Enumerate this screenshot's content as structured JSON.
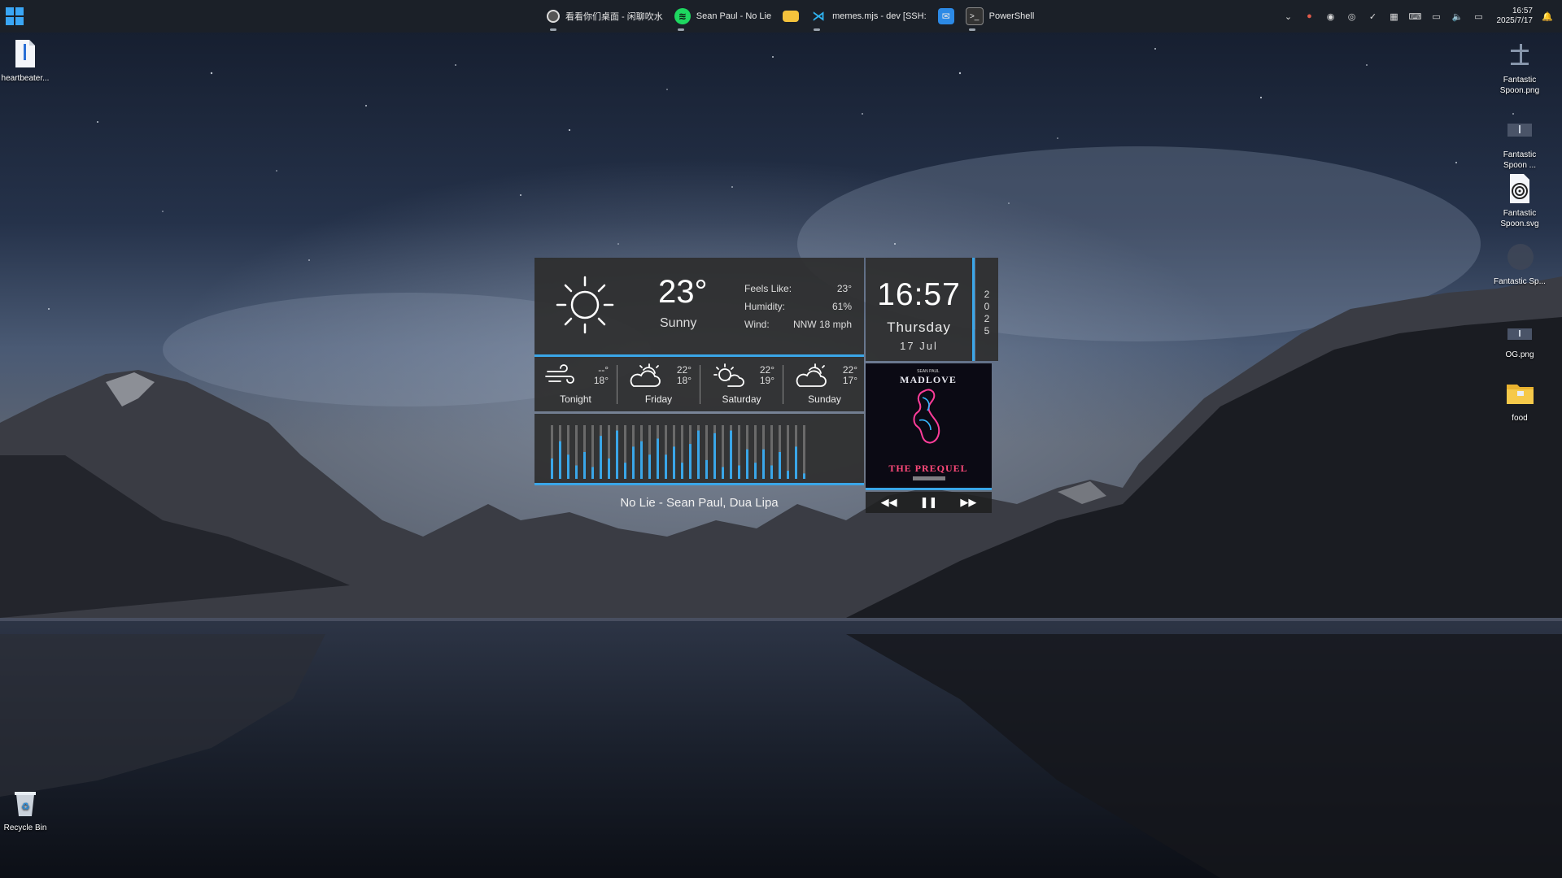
{
  "taskbar": {
    "apps": [
      {
        "label": "看看你们桌面 - 闲聊吹水",
        "icon": "chrome-icon"
      },
      {
        "label": "Sean Paul - No Lie",
        "icon": "spotify-icon"
      },
      {
        "label": "",
        "icon": "file-explorer-icon"
      },
      {
        "label": "memes.mjs - dev [SSH:",
        "icon": "vscode-icon"
      },
      {
        "label": "",
        "icon": "mail-icon"
      },
      {
        "label": "PowerShell",
        "icon": "powershell-icon"
      }
    ],
    "clock_time": "16:57",
    "clock_date": "2025/7/17"
  },
  "desktop": {
    "left_icons": [
      {
        "label": "heartbeater...",
        "icon": "zip-file-icon"
      },
      {
        "label": "Recycle Bin",
        "icon": "recycle-bin-icon"
      }
    ],
    "right_icons": [
      {
        "label": "Fantastic Spoon.png",
        "icon": "image-file-icon"
      },
      {
        "label": "Fantastic Spoon ...",
        "icon": "image-file-icon"
      },
      {
        "label": "Fantastic Spoon.svg",
        "icon": "svg-file-icon"
      },
      {
        "label": "Fantastic Sp...",
        "icon": "image-file-icon"
      },
      {
        "label": "OG.png",
        "icon": "image-file-icon"
      },
      {
        "label": "food",
        "icon": "folder-icon"
      }
    ]
  },
  "weather": {
    "temp": "23°",
    "condition": "Sunny",
    "feels_like_label": "Feels Like:",
    "feels_like": "23°",
    "humidity_label": "Humidity:",
    "humidity": "61%",
    "wind_label": "Wind:",
    "wind": "NNW  18 mph",
    "forecast": [
      {
        "name": "Tonight",
        "hi": "--°",
        "lo": "18°",
        "icon": "wind-icon"
      },
      {
        "name": "Friday",
        "hi": "22°",
        "lo": "18°",
        "icon": "partly-cloudy-icon"
      },
      {
        "name": "Saturday",
        "hi": "22°",
        "lo": "19°",
        "icon": "sun-cloud-icon"
      },
      {
        "name": "Sunday",
        "hi": "22°",
        "lo": "17°",
        "icon": "partly-cloudy-icon"
      }
    ]
  },
  "clock": {
    "time": "16:57",
    "day": "Thursday",
    "date": "17  Jul",
    "year_digits": [
      "2",
      "0",
      "2",
      "5"
    ]
  },
  "music": {
    "song": "No Lie - Sean Paul, Dua Lipa",
    "album_artist_text": "SEAN PAUL",
    "album_title_top": "MADLOVE",
    "album_title_bottom": "THE PREQUEL",
    "visualizer_levels": [
      0.38,
      0.7,
      0.45,
      0.25,
      0.5,
      0.22,
      0.8,
      0.38,
      0.9,
      0.3,
      0.6,
      0.7,
      0.45,
      0.75,
      0.45,
      0.6,
      0.3,
      0.65,
      0.9,
      0.35,
      0.85,
      0.22,
      0.9,
      0.25,
      0.55,
      0.3,
      0.55,
      0.25,
      0.5,
      0.15,
      0.6,
      0.1
    ]
  },
  "colors": {
    "accent": "#3aa6e8",
    "panel": "#2e2e2e"
  }
}
